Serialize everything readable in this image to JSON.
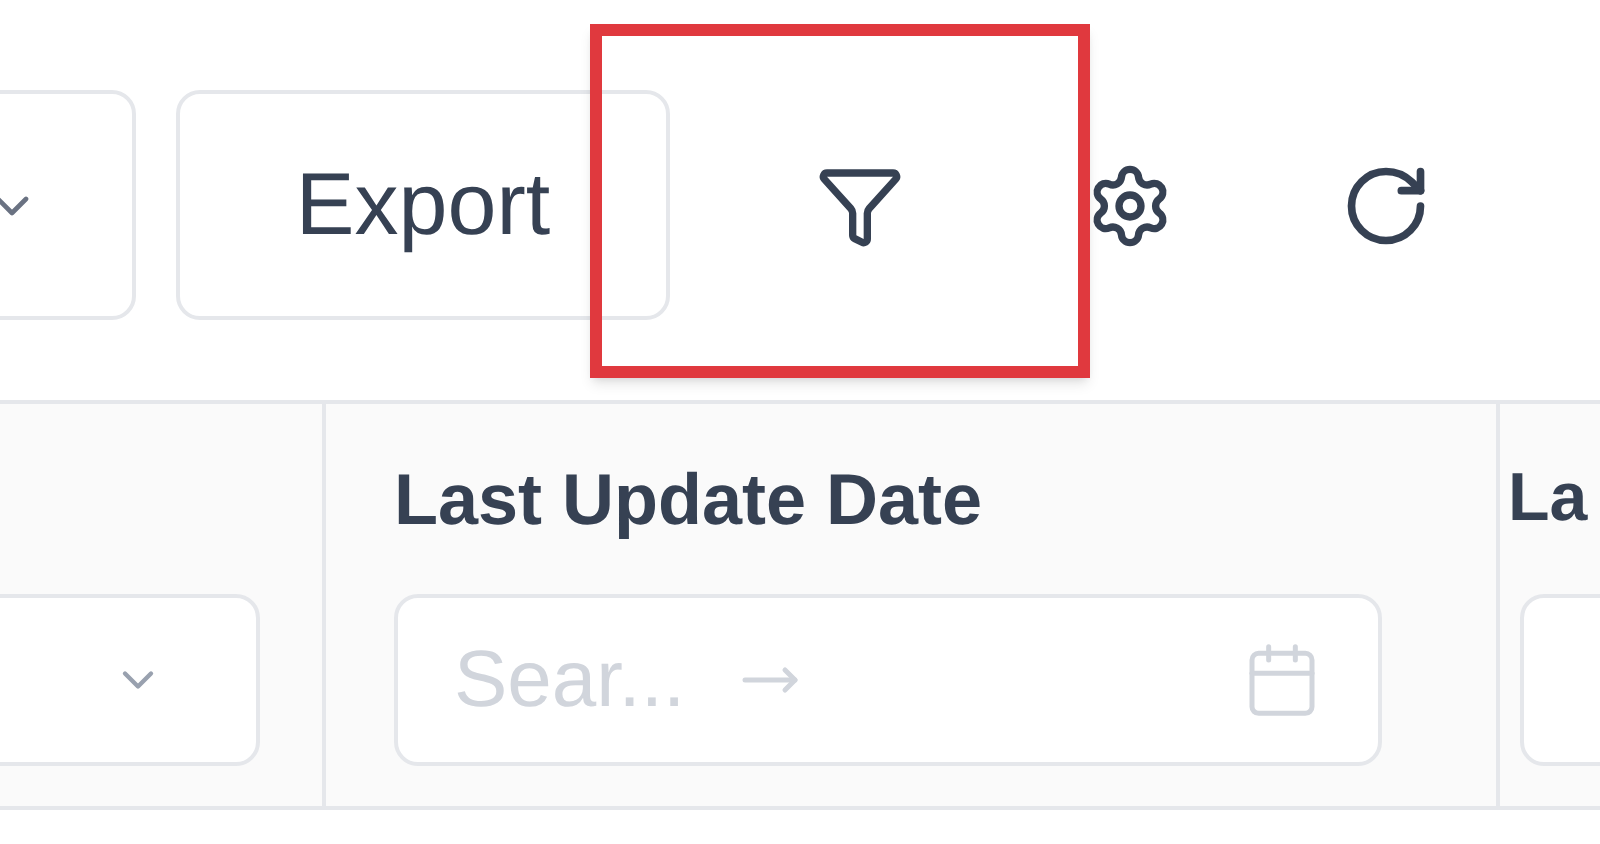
{
  "toolbar": {
    "export_label": "Export",
    "filter_highlighted": true
  },
  "columns": [
    {
      "filter": {
        "kind": "select"
      }
    },
    {
      "title": "Last Update Date",
      "filter": {
        "kind": "date-range",
        "placeholder": "Sear..."
      }
    },
    {
      "title": "La",
      "filter": {
        "kind": "input"
      }
    }
  ]
}
